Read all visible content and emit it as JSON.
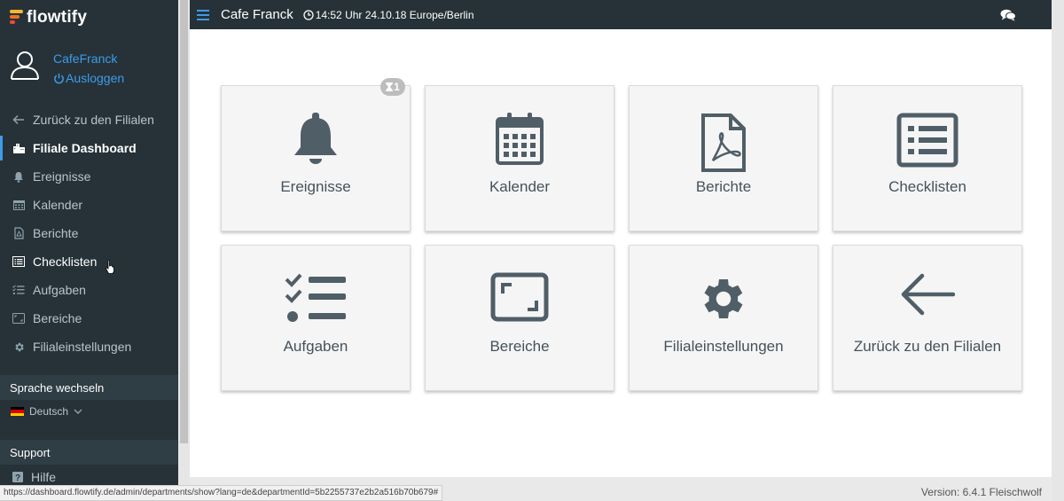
{
  "brand": {
    "name": "flowtify",
    "colors": [
      "#f7b731",
      "#f36f21",
      "#e84c3d"
    ]
  },
  "user": {
    "name": "CafeFranck",
    "logout_label": "Ausloggen"
  },
  "nav": [
    {
      "label": "Zurück zu den Filialen",
      "icon": "arrow-left-icon",
      "active": false
    },
    {
      "label": "Filiale Dashboard",
      "icon": "building-icon",
      "active": true
    },
    {
      "label": "Ereignisse",
      "icon": "bell-icon",
      "active": false
    },
    {
      "label": "Kalender",
      "icon": "calendar-icon",
      "active": false
    },
    {
      "label": "Berichte",
      "icon": "pdf-file-icon",
      "active": false
    },
    {
      "label": "Checklisten",
      "icon": "list-icon",
      "active": false
    },
    {
      "label": "Aufgaben",
      "icon": "tasks-icon",
      "active": false
    },
    {
      "label": "Bereiche",
      "icon": "area-icon",
      "active": false
    },
    {
      "label": "Filialeinstellungen",
      "icon": "gear-icon",
      "active": false
    }
  ],
  "language": {
    "section_label": "Sprache wechseln",
    "selected": "Deutsch"
  },
  "support": {
    "section_label": "Support",
    "help_label": "Hilfe"
  },
  "topbar": {
    "title": "Cafe Franck",
    "clock": "14:52 Uhr 24.10.18 Europe/Berlin"
  },
  "tiles": [
    {
      "label": "Ereignisse",
      "icon": "bell-icon",
      "badge": "1"
    },
    {
      "label": "Kalender",
      "icon": "calendar-icon"
    },
    {
      "label": "Berichte",
      "icon": "pdf-file-icon"
    },
    {
      "label": "Checklisten",
      "icon": "list-icon"
    },
    {
      "label": "Aufgaben",
      "icon": "tasks-icon"
    },
    {
      "label": "Bereiche",
      "icon": "area-icon"
    },
    {
      "label": "Filialeinstellungen",
      "icon": "gear-icon"
    },
    {
      "label": "Zurück zu den Filialen",
      "icon": "arrow-left-icon"
    }
  ],
  "status_url": "https://dashboard.flowtify.de/admin/departments/show?lang=de&departmentId=5b2255737e2b2a516b70b679#",
  "version": "Version: 6.4.1 Fleischwolf",
  "colors": {
    "sidebar_bg": "#263238",
    "accent": "#3d9be9",
    "tile_icon": "#4f5e67"
  }
}
